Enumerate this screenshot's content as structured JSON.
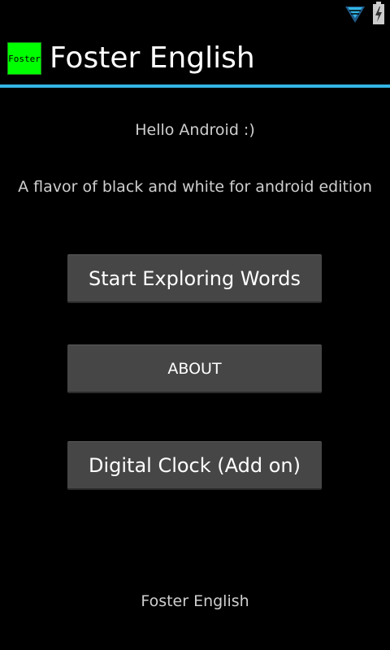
{
  "status_bar": {
    "icons": [
      "wifi-signal-icon",
      "battery-charging-icon"
    ]
  },
  "action_bar": {
    "logo_text": "Foster",
    "title": "Foster English",
    "accent_color": "#33b5e5",
    "logo_color": "#00ff00"
  },
  "main": {
    "greeting": "Hello Android :)",
    "subtitle": "A flavor of black and white for android edition",
    "buttons": {
      "explore": "Start Exploring Words",
      "about": "ABOUT",
      "clock": "Digital Clock (Add on)"
    },
    "footer": "Foster English"
  }
}
